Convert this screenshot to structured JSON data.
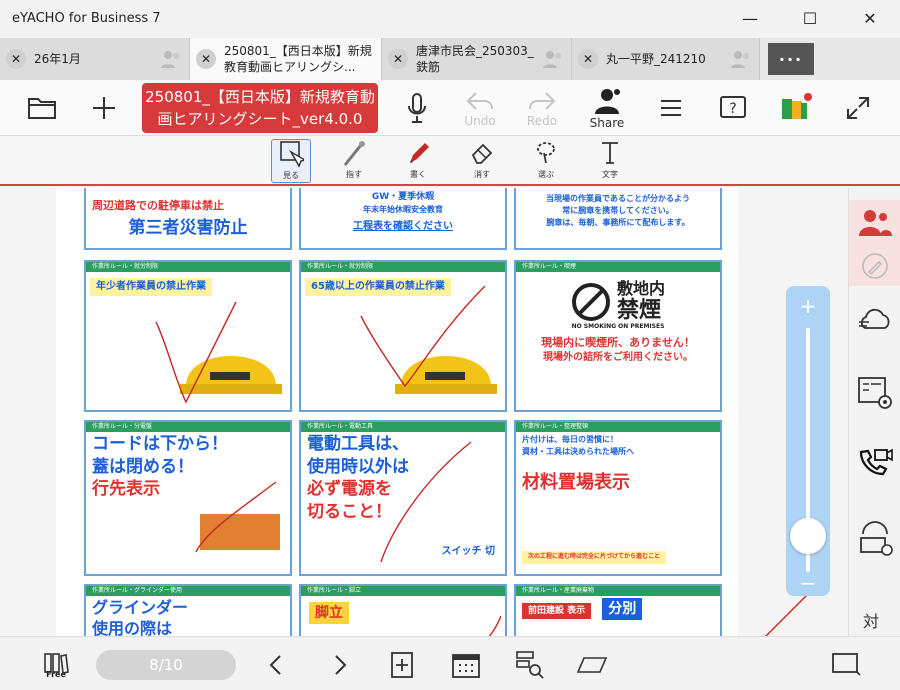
{
  "app": {
    "title": "eYACHO for Business 7"
  },
  "window": {
    "minimize": "—",
    "maximize": "☐",
    "close": "✕"
  },
  "tabs": [
    {
      "label": "26年1月",
      "close": "✕"
    },
    {
      "label": "250801_【西日本版】新規教育動画ヒアリングシ...",
      "close": "✕"
    },
    {
      "label": "唐津市民会_250303_鉄筋",
      "close": "✕"
    },
    {
      "label": "丸一平野_241210",
      "close": "✕"
    }
  ],
  "more_label": "···",
  "toolbar": {
    "doc_title": "250801_【西日本版】新規教育動画ヒアリングシート_ver4.0.0",
    "undo": "Undo",
    "redo": "Redo",
    "share": "Share"
  },
  "tools": [
    {
      "label": "見る"
    },
    {
      "label": "指す"
    },
    {
      "label": "書く"
    },
    {
      "label": "消す"
    },
    {
      "label": "選ぶ"
    },
    {
      "label": "文字"
    }
  ],
  "slides": {
    "r0c0": {
      "text1": "周辺道路での駐停車は禁止",
      "text2": "第三者災害防止"
    },
    "r0c1": {
      "text1": "GW・夏季休暇",
      "text2": "年末年始休暇安全教育",
      "text3": "工程表を確認ください"
    },
    "r0c2": {
      "text1": "当現場の作業員であることが分かるよう",
      "text2": "常に腕章を携帯してください。",
      "text3": "腕章は、毎朝、事務所にて配布します。"
    },
    "r1c0": {
      "header": "作業所ルール・就労制限",
      "text": "年少者作業員の禁止作業"
    },
    "r1c1": {
      "header": "作業所ルール・就労制限",
      "text": "65歳以上の作業員の禁止作業"
    },
    "r1c2": {
      "header": "作業所ルール・喫煙",
      "text1": "敷地内",
      "text2": "禁煙",
      "text3": "NO SMOKING ON PREMISES",
      "text4": "現場内に喫煙所、ありません！",
      "text5": "現場外の詰所をご利用ください。"
    },
    "r2c0": {
      "header": "作業所ルール・分電盤",
      "text1": "コードは下から！",
      "text2": "蓋は閉める！",
      "text3": "行先表示"
    },
    "r2c1": {
      "header": "作業所ルール・電動工具",
      "text1": "電動工具は、",
      "text2": "使用時以外は",
      "text3": "必ず電源を",
      "text4": "切ること！",
      "text5": "スイッチ 切"
    },
    "r2c2": {
      "header": "作業所ルール・整理整頓",
      "text1": "片付けは、毎日の習慣に！",
      "text2": "資材・工具は決められた場所へ",
      "text3": "材料置場表示",
      "text4": "次の工程に進む時は完全に片づけてから進むこと"
    },
    "r3c0": {
      "header": "作業所ルール・グラインダー使用",
      "text1": "グラインダー",
      "text2": "使用の際は"
    },
    "r3c1": {
      "header": "作業所ルール・脚立",
      "text": "脚立"
    },
    "r3c2": {
      "header": "作業所ルール・産業廃棄物",
      "text1": "前田建設 表示",
      "text2": "分別"
    }
  },
  "pager": {
    "text": "8/10"
  },
  "free_label": "Free",
  "side_extra": "対"
}
